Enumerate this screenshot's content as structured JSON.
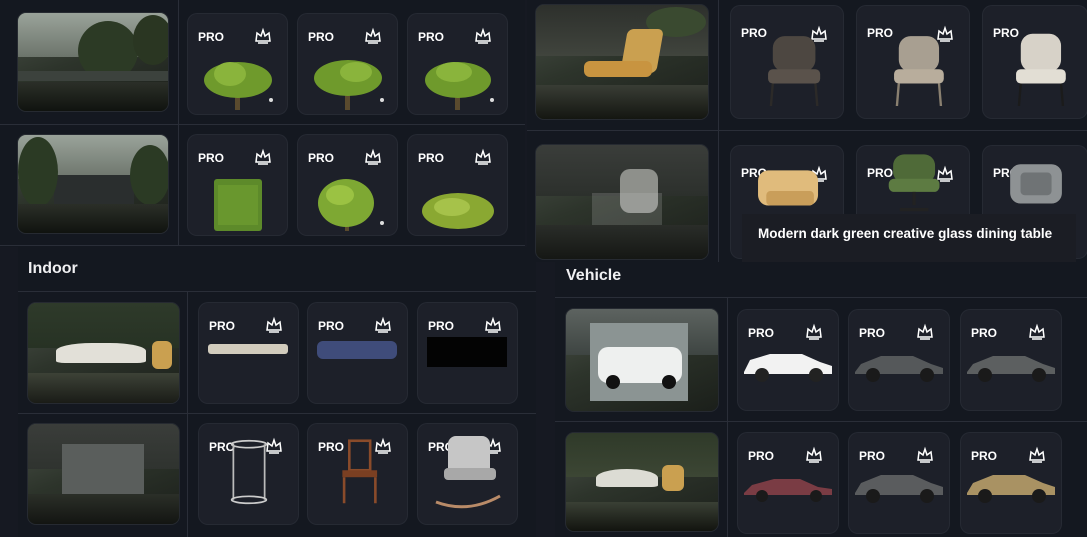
{
  "colors": {
    "background": "#161922",
    "tile": "#1d2029",
    "foliage": "#7aa632",
    "text": "#ffffff"
  },
  "badge": {
    "pro": "PRO",
    "icon": "crown-icon"
  },
  "sections": {
    "indoor": {
      "title": "Indoor"
    },
    "vehicle": {
      "title": "Vehicle"
    }
  },
  "tooltip": {
    "text": "Modern dark green creative glass dining table"
  },
  "rows": [
    {
      "section": "plants",
      "items": [
        "tree",
        "tree",
        "tree"
      ]
    },
    {
      "section": "plants",
      "items": [
        "hedge",
        "shrub",
        "bush"
      ]
    },
    {
      "section": "furniture",
      "items": [
        "dark-chair",
        "beige-chair",
        "white-chair"
      ]
    },
    {
      "section": "furniture",
      "items": [
        "tan-armchair",
        "green-swivel-chair",
        "grey-armchair"
      ]
    },
    {
      "section": "indoor",
      "items": [
        "cushion",
        "blue-ottoman",
        "black-bench"
      ]
    },
    {
      "section": "indoor",
      "items": [
        "side-table",
        "wood-chair",
        "rocking-chair"
      ]
    },
    {
      "section": "vehicle",
      "items": [
        "white-suv",
        "dark-sedan",
        "dark-sedan"
      ]
    },
    {
      "section": "vehicle",
      "items": [
        "classic-car",
        "grey-sedan",
        "gold-sedan"
      ]
    }
  ]
}
